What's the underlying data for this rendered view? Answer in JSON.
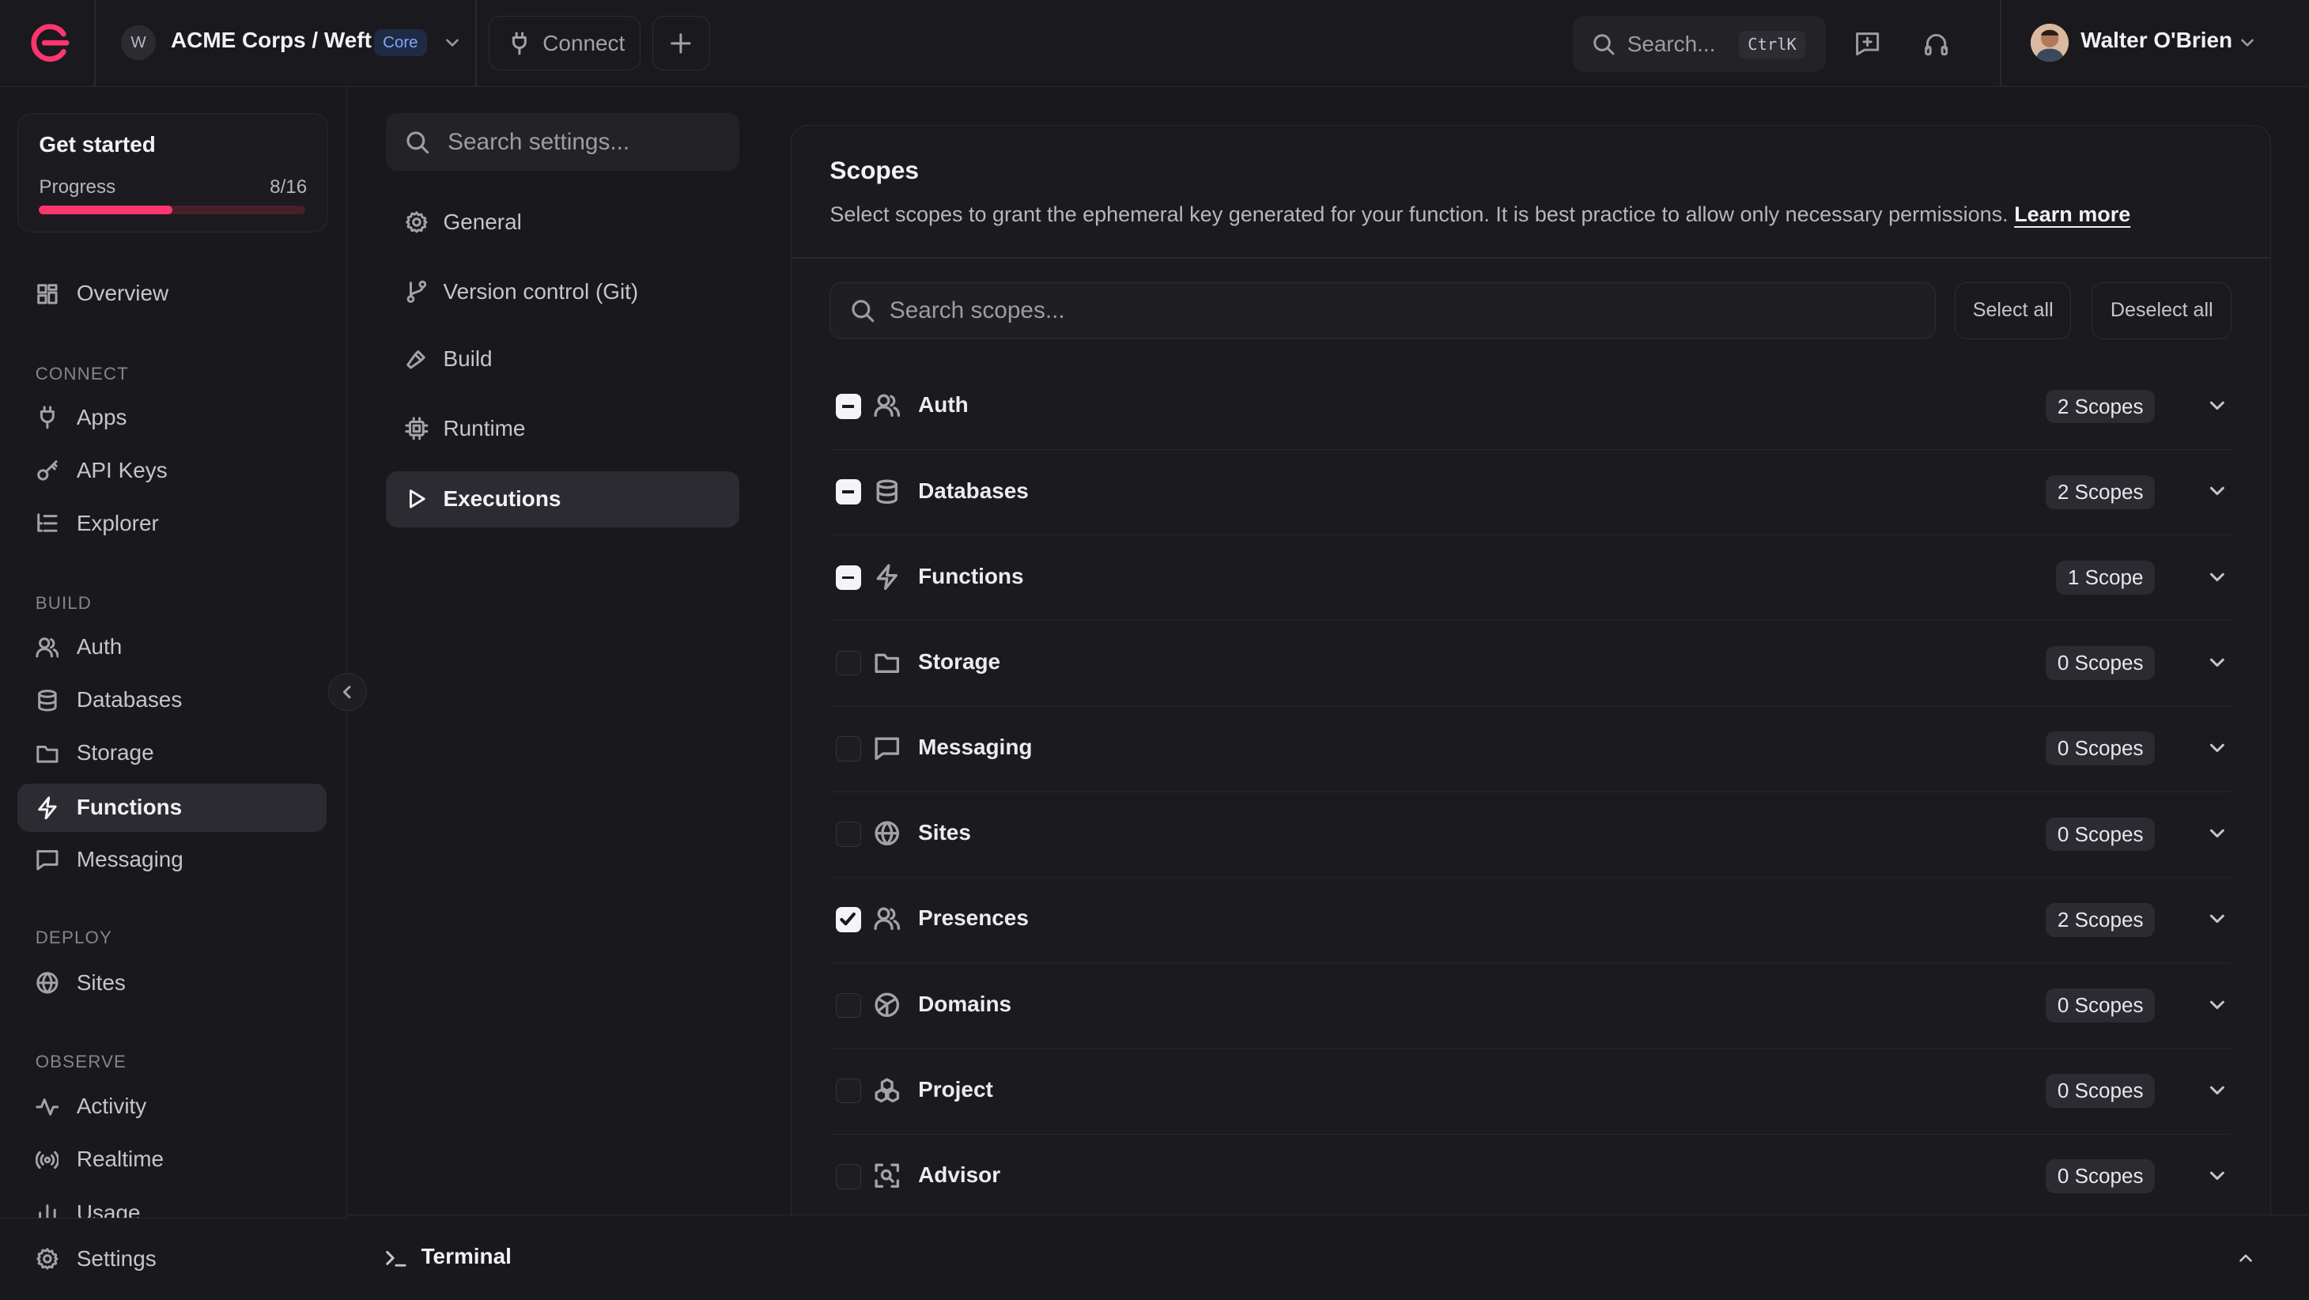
{
  "topbar": {
    "org_initial": "W",
    "org_name": "ACME Corps / Weft",
    "plan_badge": "Core",
    "connect_label": "Connect",
    "search_placeholder": "Search...",
    "search_shortcut": "CtrlK",
    "user_name": "Walter O'Brien"
  },
  "sidebar": {
    "get_started": {
      "title": "Get started",
      "progress_label": "Progress",
      "progress_text": "8/16",
      "progress_fraction": 0.5
    },
    "overview": "Overview",
    "sections": {
      "connect": "CONNECT",
      "build": "BUILD",
      "deploy": "DEPLOY",
      "observe": "OBSERVE"
    },
    "items": {
      "apps": "Apps",
      "api_keys": "API Keys",
      "explorer": "Explorer",
      "auth": "Auth",
      "databases": "Databases",
      "storage": "Storage",
      "functions": "Functions",
      "messaging": "Messaging",
      "sites": "Sites",
      "activity": "Activity",
      "realtime": "Realtime",
      "usage": "Usage"
    },
    "settings": "Settings",
    "active_item": "Functions"
  },
  "settings_nav": {
    "search_placeholder": "Search settings...",
    "items": [
      "General",
      "Version control (Git)",
      "Build",
      "Runtime",
      "Executions"
    ],
    "active_item": "Executions"
  },
  "scopes": {
    "title": "Scopes",
    "description": "Select scopes to grant the ephemeral key generated for your function. It is best practice to allow only necessary permissions.",
    "learn_more": "Learn more",
    "search_placeholder": "Search scopes...",
    "select_all": "Select all",
    "deselect_all": "Deselect all",
    "rows": [
      {
        "name": "Auth",
        "count": "2 Scopes",
        "state": "partial",
        "icon": "users-icon"
      },
      {
        "name": "Databases",
        "count": "2 Scopes",
        "state": "partial",
        "icon": "database-icon"
      },
      {
        "name": "Functions",
        "count": "1 Scope",
        "state": "partial",
        "icon": "lightning-icon"
      },
      {
        "name": "Storage",
        "count": "0 Scopes",
        "state": "unchecked",
        "icon": "folder-icon"
      },
      {
        "name": "Messaging",
        "count": "0 Scopes",
        "state": "unchecked",
        "icon": "chat-icon"
      },
      {
        "name": "Sites",
        "count": "0 Scopes",
        "state": "unchecked",
        "icon": "globe-icon"
      },
      {
        "name": "Presences",
        "count": "2 Scopes",
        "state": "checked",
        "icon": "users-icon"
      },
      {
        "name": "Domains",
        "count": "0 Scopes",
        "state": "unchecked",
        "icon": "globe-grid-icon"
      },
      {
        "name": "Project",
        "count": "0 Scopes",
        "state": "unchecked",
        "icon": "cubes-icon"
      },
      {
        "name": "Advisor",
        "count": "0 Scopes",
        "state": "unchecked",
        "icon": "scan-icon"
      }
    ]
  },
  "terminal": {
    "label": "Terminal"
  },
  "colors": {
    "accent": "#fd366e",
    "background": "#19181d",
    "badge_bg": "#1f2a44",
    "badge_text": "#7fa6f5"
  }
}
